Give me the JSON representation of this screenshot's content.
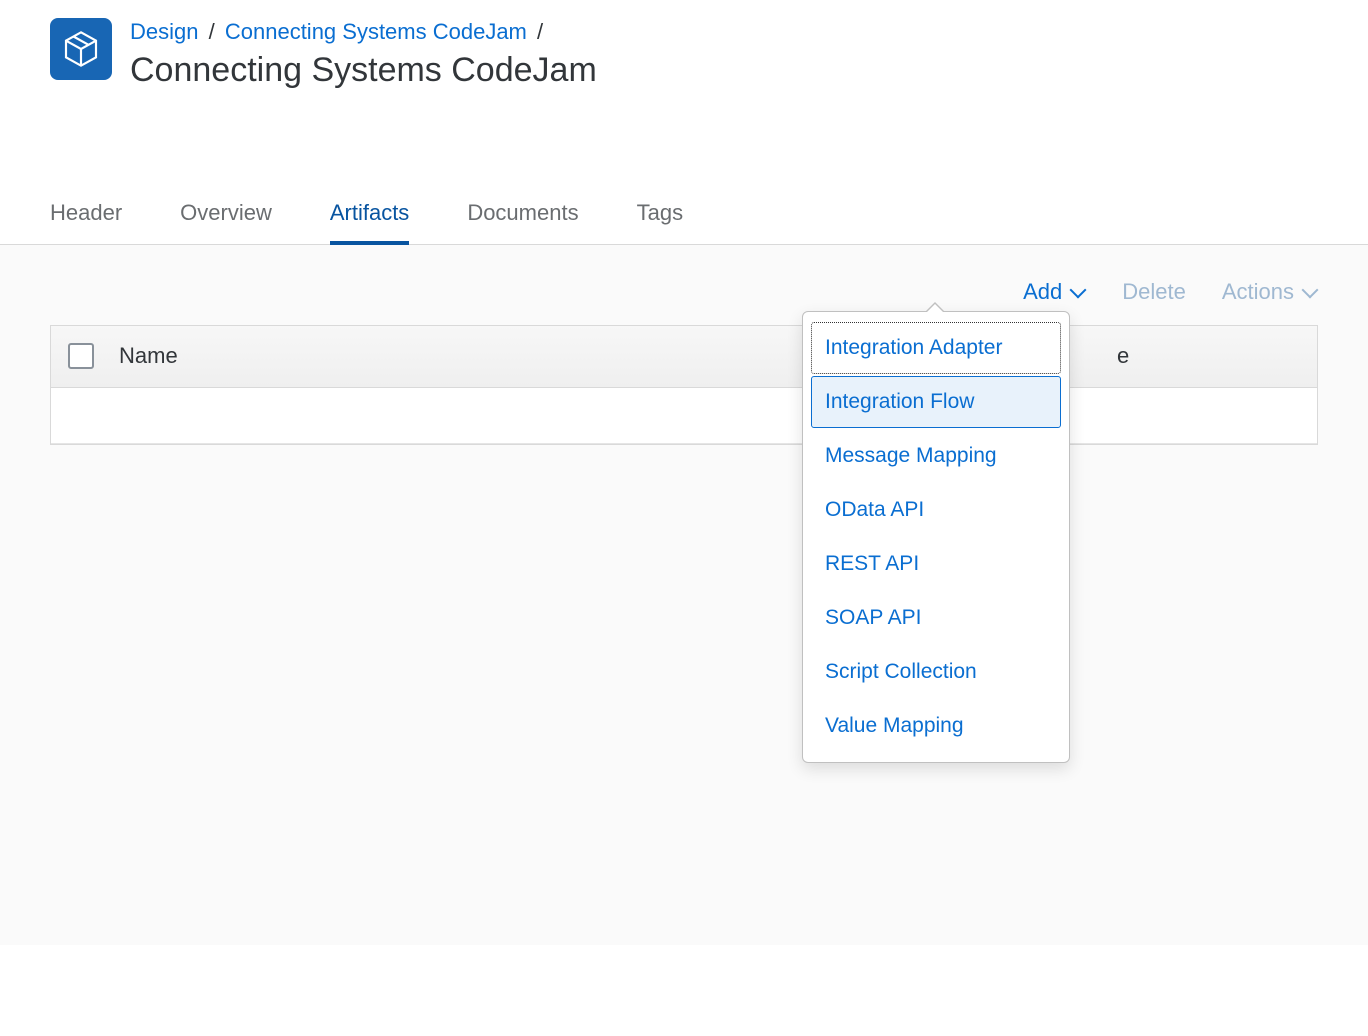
{
  "breadcrumb": {
    "root": "Design",
    "package": "Connecting Systems CodeJam"
  },
  "page_title": "Connecting Systems CodeJam",
  "tabs": {
    "header": "Header",
    "overview": "Overview",
    "artifacts": "Artifacts",
    "documents": "Documents",
    "tags": "Tags"
  },
  "toolbar": {
    "add": "Add",
    "delete": "Delete",
    "actions": "Actions"
  },
  "table": {
    "col_name": "Name",
    "col_type_fragment": "e"
  },
  "add_menu": {
    "items": [
      "Integration Adapter",
      "Integration Flow",
      "Message Mapping",
      "OData API",
      "REST API",
      "SOAP API",
      "Script Collection",
      "Value Mapping"
    ]
  }
}
